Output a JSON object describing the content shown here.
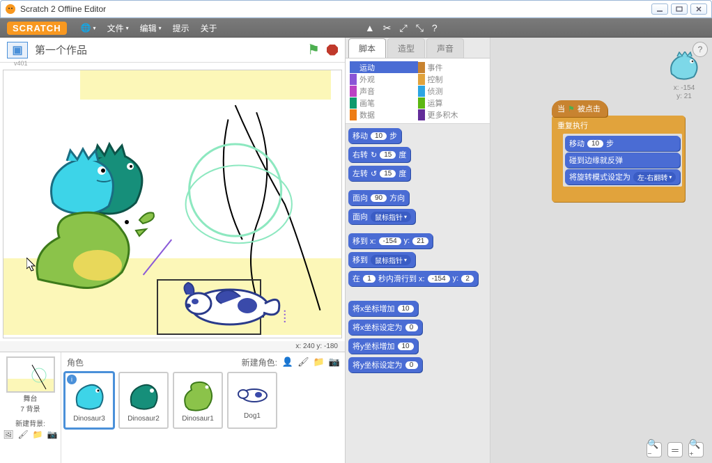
{
  "window": {
    "title": "Scratch 2 Offline Editor"
  },
  "menu": {
    "logo": "SCRATCH",
    "file": "文件",
    "edit": "编辑",
    "tips": "提示",
    "about": "关于"
  },
  "stage": {
    "project_name": "第一个作品",
    "coord_label": "x: 240  y: -180",
    "mini_coord": "v401"
  },
  "sprite_panel": {
    "sprites_label": "角色",
    "new_sprite_label": "新建角色:",
    "stage_label": "舞台",
    "backdrop_count": "7 背景",
    "new_backdrop": "新建背景:"
  },
  "sprites": [
    {
      "name": "Dinosaur3",
      "selected": true
    },
    {
      "name": "Dinosaur2",
      "selected": false
    },
    {
      "name": "Dinosaur1",
      "selected": false
    },
    {
      "name": "Dog1",
      "selected": false
    }
  ],
  "tabs": {
    "scripts": "脚本",
    "costumes": "造型",
    "sounds": "声音"
  },
  "categories": {
    "motion": "运动",
    "looks": "外观",
    "sound": "声音",
    "pen": "画笔",
    "data": "数据",
    "events": "事件",
    "control": "控制",
    "sensing": "侦测",
    "operators": "运算",
    "more": "更多积木"
  },
  "blocks": {
    "move_steps_a": "移动",
    "move_steps_b": "步",
    "move_steps_v": "10",
    "turn_cw_a": "右转",
    "turn_cw_b": "度",
    "turn_cw_v": "15",
    "turn_ccw_a": "左转",
    "turn_ccw_b": "度",
    "turn_ccw_v": "15",
    "point_dir_a": "面向",
    "point_dir_b": "方向",
    "point_dir_v": "90",
    "point_towards_a": "面向",
    "point_towards_v": "鼠标指针",
    "goto_xy_a": "移到 x:",
    "goto_xy_b": "y:",
    "goto_xy_x": "-154",
    "goto_xy_y": "21",
    "goto_a": "移到",
    "goto_v": "鼠标指针",
    "glide_a": "在",
    "glide_b": "秒内滑行到 x:",
    "glide_c": "y:",
    "glide_t": "1",
    "glide_x": "-154",
    "glide_y": "2",
    "changex_a": "将x坐标增加",
    "changex_v": "10",
    "setx_a": "将x坐标设定为",
    "setx_v": "0",
    "changey_a": "将y坐标增加",
    "changey_v": "10",
    "sety_a": "将y坐标设定为",
    "sety_v": "0"
  },
  "script_info": {
    "x_label": "x: -154",
    "y_label": "y: 21"
  },
  "script_blocks": {
    "when_clicked": "当",
    "when_clicked_b": "被点击",
    "forever": "重复执行",
    "move_a": "移动",
    "move_v": "10",
    "move_b": "步",
    "bounce": "碰到边缘就反弹",
    "rotstyle_a": "将旋转模式设定为",
    "rotstyle_v": "左-右翻转"
  }
}
